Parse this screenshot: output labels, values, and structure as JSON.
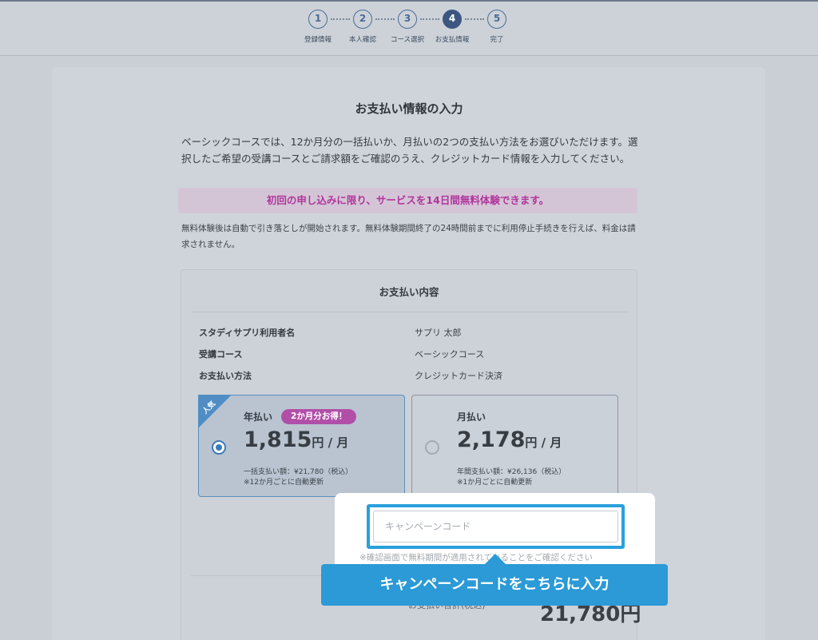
{
  "stepper": {
    "steps": [
      {
        "num": "1",
        "label": "登録情報"
      },
      {
        "num": "2",
        "label": "本人確認"
      },
      {
        "num": "3",
        "label": "コース選択"
      },
      {
        "num": "4",
        "label": "お支払情報"
      },
      {
        "num": "5",
        "label": "完了"
      }
    ],
    "active_step": 4
  },
  "page": {
    "title": "お支払い情報の入力",
    "intro": "ベーシックコースでは、12か月分の一括払いか、月払いの2つの支払い方法をお選びいただけます。選択したご希望の受講コースとご請求額をご確認のうえ、クレジットカード情報を入力してください。",
    "promo": "初回の申し込みに限り、サービスを14日間無料体験できます。",
    "note": "無料体験後は自動で引き落としが開始されます。無料体験期間終了の24時間前までに利用停止手続きを行えば、料金は請求されません。"
  },
  "payment": {
    "heading": "お支払い内容",
    "rows": [
      {
        "key": "スタディサプリ利用者名",
        "value": "サプリ 太郎"
      },
      {
        "key": "受講コース",
        "value": "ベーシックコース"
      },
      {
        "key": "お支払い方法",
        "value": "クレジットカード決済"
      }
    ],
    "options": [
      {
        "ribbon": "人気",
        "name": "年払い",
        "badge": "2か月分お得！",
        "price": "1,815",
        "unit": "円 / 月",
        "line1": "一括支払い額：¥21,780（税込）",
        "line2": "※12か月ごとに自動更新",
        "selected": true
      },
      {
        "name": "月払い",
        "price": "2,178",
        "unit": "円 / 月",
        "line1": "年間支払い額：¥26,136（税込）",
        "line2": "※1か月ごとに自動更新",
        "selected": false
      }
    ],
    "campaign_placeholder": "キャンペーンコード",
    "campaign_note": "※確認画面で無料期間が適用されていることをご確認ください",
    "total_label": "お支払い合計(税込)",
    "total_value": "21,780円"
  },
  "callout": {
    "text": "キャンペーンコードをこちらに入力"
  },
  "colors": {
    "accent": "#2b9ad6",
    "promo_text": "#b0359c",
    "badge": "#b14fa8",
    "step_active": "#3d5680"
  }
}
